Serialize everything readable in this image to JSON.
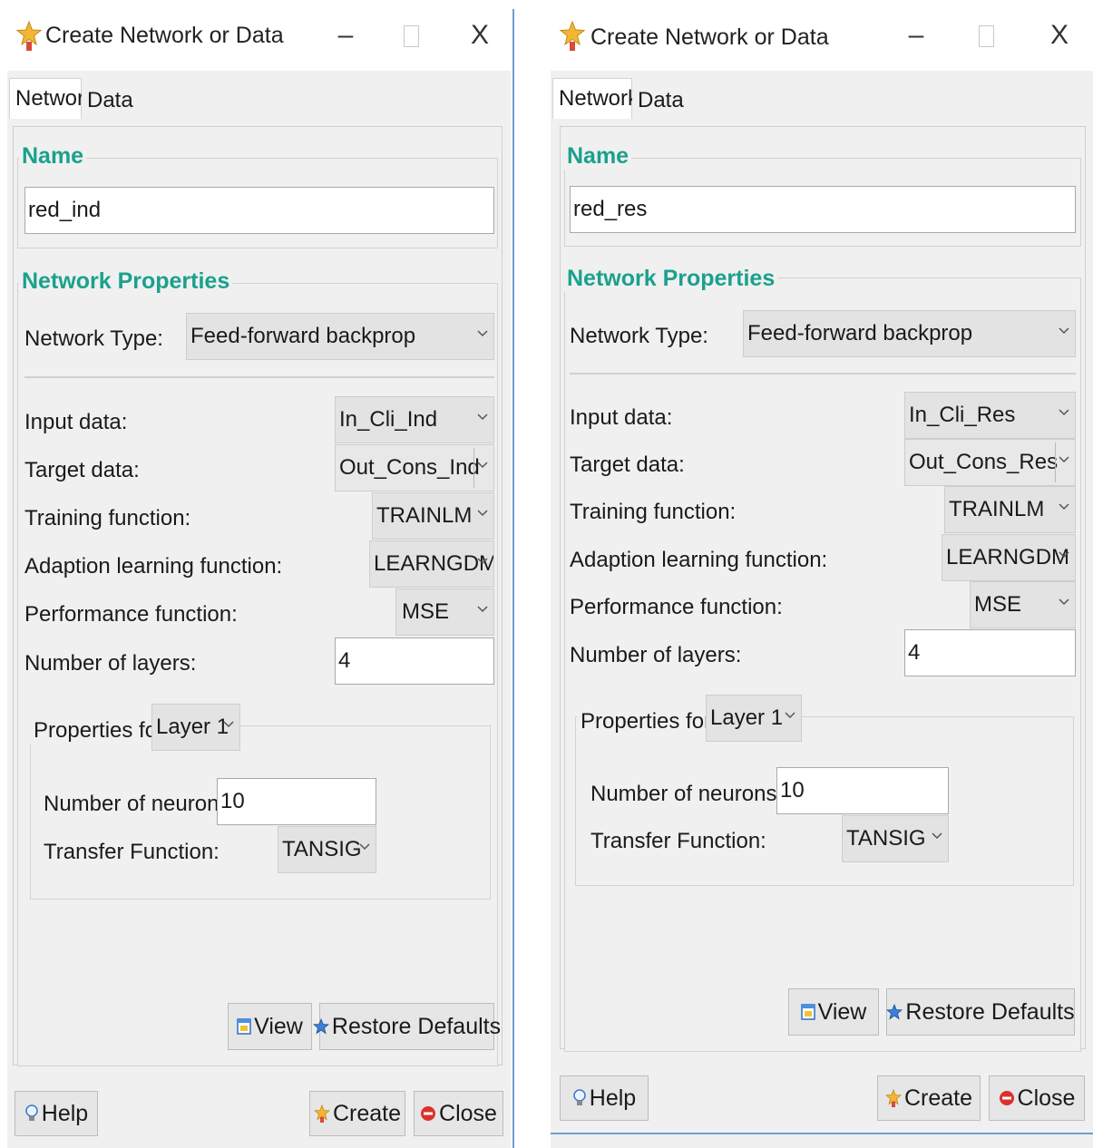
{
  "windows": [
    {
      "id": "left",
      "title": "Create Network or Data",
      "controls": {
        "minimize": "–",
        "close": "X"
      },
      "tabs": [
        {
          "label": "Network",
          "active": true
        },
        {
          "label": "Data",
          "active": false
        }
      ],
      "name_section": {
        "legend": "Name",
        "value": "red_ind"
      },
      "network_properties": {
        "legend": "Network Properties",
        "network_type_label": "Network Type:",
        "network_type_value": "Feed-forward backprop",
        "input_data_label": "Input data:",
        "input_data_value": "In_Cli_Ind",
        "target_data_label": "Target data:",
        "target_data_value": "Out_Cons_Ind",
        "training_function_label": "Training function:",
        "training_function_value": "TRAINLM",
        "adaption_label": "Adaption learning function:",
        "adaption_value": "LEARNGDM",
        "performance_label": "Performance function:",
        "performance_value": "MSE",
        "layers_label": "Number of layers:",
        "layers_value": "4"
      },
      "layer_properties": {
        "legend": "Properties for:",
        "layer_value": "Layer 1",
        "neurons_label": "Number of neurons:",
        "neurons_value": "10",
        "transfer_label": "Transfer Function:",
        "transfer_value": "TANSIG"
      },
      "buttons": {
        "view": "View",
        "restore": "Restore Defaults",
        "help": "Help",
        "create": "Create",
        "close": "Close"
      }
    },
    {
      "id": "right",
      "title": "Create Network or Data",
      "controls": {
        "minimize": "–",
        "close": "X"
      },
      "tabs": [
        {
          "label": "Network",
          "active": true
        },
        {
          "label": "Data",
          "active": false
        }
      ],
      "name_section": {
        "legend": "Name",
        "value": "red_res"
      },
      "network_properties": {
        "legend": "Network Properties",
        "network_type_label": "Network Type:",
        "network_type_value": "Feed-forward backprop",
        "input_data_label": "Input data:",
        "input_data_value": "In_Cli_Res",
        "target_data_label": "Target data:",
        "target_data_value": "Out_Cons_Res",
        "training_function_label": "Training function:",
        "training_function_value": "TRAINLM",
        "adaption_label": "Adaption learning function:",
        "adaption_value": "LEARNGDM",
        "performance_label": "Performance function:",
        "performance_value": "MSE",
        "layers_label": "Number of layers:",
        "layers_value": "4"
      },
      "layer_properties": {
        "legend": "Properties for:",
        "layer_value": "Layer 1",
        "neurons_label": "Number of neurons:",
        "neurons_value": "10",
        "transfer_label": "Transfer Function:",
        "transfer_value": "TANSIG"
      },
      "buttons": {
        "view": "View",
        "restore": "Restore Defaults",
        "help": "Help",
        "create": "Create",
        "close": "Close"
      }
    }
  ],
  "icons": {
    "title": "nntool-star-icon",
    "view": "view-window-icon",
    "restore": "restore-star-icon",
    "help": "help-bulb-icon",
    "create": "create-star-icon",
    "close": "close-stop-icon",
    "dropdown": "chevron-down-icon"
  },
  "colors": {
    "legend_text": "#1aa18d",
    "dialog_background": "#f0f0f0",
    "window_divider": "#6f9fd0"
  }
}
